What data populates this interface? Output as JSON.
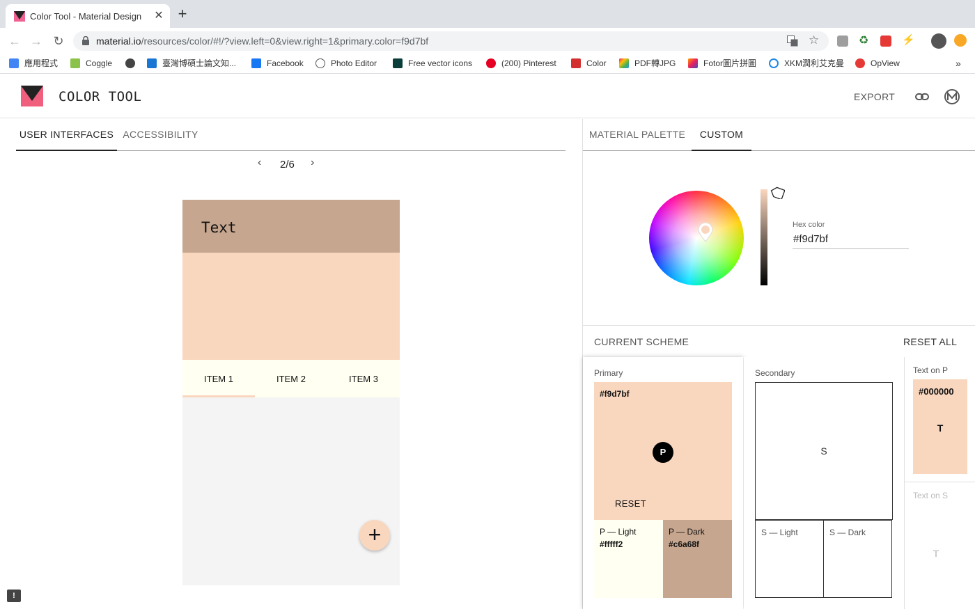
{
  "browser": {
    "tab_title": "Color Tool - Material Design",
    "tab_close": "✕",
    "new_tab": "+",
    "url_host": "material.io",
    "url_path": "/resources/color/#!/?view.left=0&view.right=1&primary.color=f9d7bf",
    "bookmarks": [
      {
        "label": "應用程式",
        "icon": "apps-grid-icon",
        "color": "#4285f4"
      },
      {
        "label": "Coggle",
        "icon": "coggle-icon",
        "color": "#8bc34a"
      },
      {
        "label": "",
        "icon": "globe-icon",
        "color": "#444444"
      },
      {
        "label": "臺灣博碩士論文知...",
        "icon": "library-icon",
        "color": "#1976d2"
      },
      {
        "label": "Facebook",
        "icon": "facebook-icon",
        "color": "#1877f2"
      },
      {
        "label": "Photo Editor",
        "icon": "aperture-icon",
        "color": "#555555"
      },
      {
        "label": "Free vector icons",
        "icon": "vector-icon",
        "color": "#0b3d3a"
      },
      {
        "label": "(200) Pinterest",
        "icon": "pinterest-icon",
        "color": "#e60023"
      },
      {
        "label": "Color",
        "icon": "color-icon",
        "color": "#d32f2f"
      },
      {
        "label": "PDF轉JPG",
        "icon": "pdf-icon",
        "color": "#e91e63"
      },
      {
        "label": "Fotor圖片拼圖",
        "icon": "fotor-icon",
        "color": "#ff9800"
      },
      {
        "label": "XKM潤利艾克曼",
        "icon": "xkm-icon",
        "color": "#1e88e5"
      },
      {
        "label": "OpView",
        "icon": "opview-icon",
        "color": "#e53935"
      }
    ],
    "bookmarks_more": "»"
  },
  "app": {
    "title": "COLOR TOOL",
    "export_label": "EXPORT",
    "left_tabs": [
      "USER INTERFACES",
      "ACCESSIBILITY"
    ],
    "right_tabs": [
      "MATERIAL PALETTE",
      "CUSTOM"
    ],
    "pager": {
      "prev": "‹",
      "count": "2/6",
      "next": "›"
    },
    "feedback": "!"
  },
  "preview": {
    "appbar_text": "Text",
    "tabs": [
      "ITEM 1",
      "ITEM 2",
      "ITEM 3"
    ],
    "fab_symbol": "+"
  },
  "custom": {
    "hex_label": "Hex color",
    "hex_value": "#f9d7bf"
  },
  "scheme": {
    "title": "CURRENT SCHEME",
    "reset_all": "RESET ALL",
    "primary": {
      "label": "Primary",
      "hex": "#f9d7bf",
      "badge": "P",
      "reset": "RESET",
      "light_label": "P — Light",
      "light_hex": "#fffff2",
      "dark_label": "P — Dark",
      "dark_hex": "#c6a68f"
    },
    "secondary": {
      "label": "Secondary",
      "badge": "S",
      "light_label": "S — Light",
      "dark_label": "S — Dark"
    },
    "text_on_p": {
      "label": "Text on P",
      "hex": "#000000",
      "badge": "T"
    },
    "text_on_s": {
      "label": "Text on S",
      "badge": "T"
    }
  },
  "colors": {
    "primary": "#f9d7bf",
    "primary_light": "#fffff2",
    "primary_dark": "#c6a68f"
  }
}
